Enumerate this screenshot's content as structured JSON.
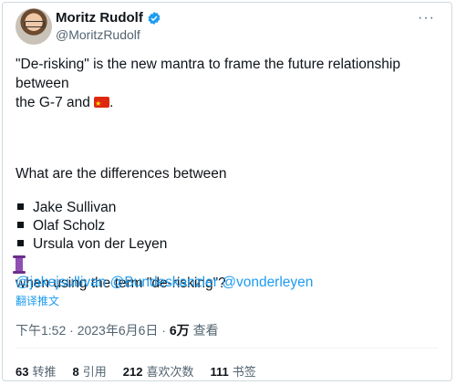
{
  "author": {
    "name": "Moritz Rudolf",
    "handle": "@MoritzRudolf"
  },
  "tweet": {
    "line1": "\"De-risking\" is the new mantra to frame the future relationship between",
    "line2": "the G-7 and",
    "line2_end": ".",
    "question": "What are the differences between",
    "names": [
      "Jake Sullivan",
      "Olaf Scholz",
      "Ursula von der Leyen"
    ],
    "closing": "when using the term \"de-risking\"?",
    "mentions": [
      "@jakejsullivan",
      "@Bundeskanzler",
      "@vonderleyen"
    ],
    "translate": "翻译推文"
  },
  "meta": {
    "time": "下午1:52",
    "date": "2023年6月6日",
    "views_count": "6万",
    "views_label": "查看"
  },
  "stats": [
    {
      "count": "63",
      "label": "转推"
    },
    {
      "count": "8",
      "label": "引用"
    },
    {
      "count": "212",
      "label": "喜欢次数"
    },
    {
      "count": "111",
      "label": "书签"
    }
  ],
  "colors": {
    "link": "#1d9bf0",
    "verified": "#1d9bf0",
    "flag": "#de2910"
  },
  "icons": [
    "verified-badge-icon",
    "more-options-icon",
    "china-flag-icon",
    "scroll-emoji-icon"
  ]
}
